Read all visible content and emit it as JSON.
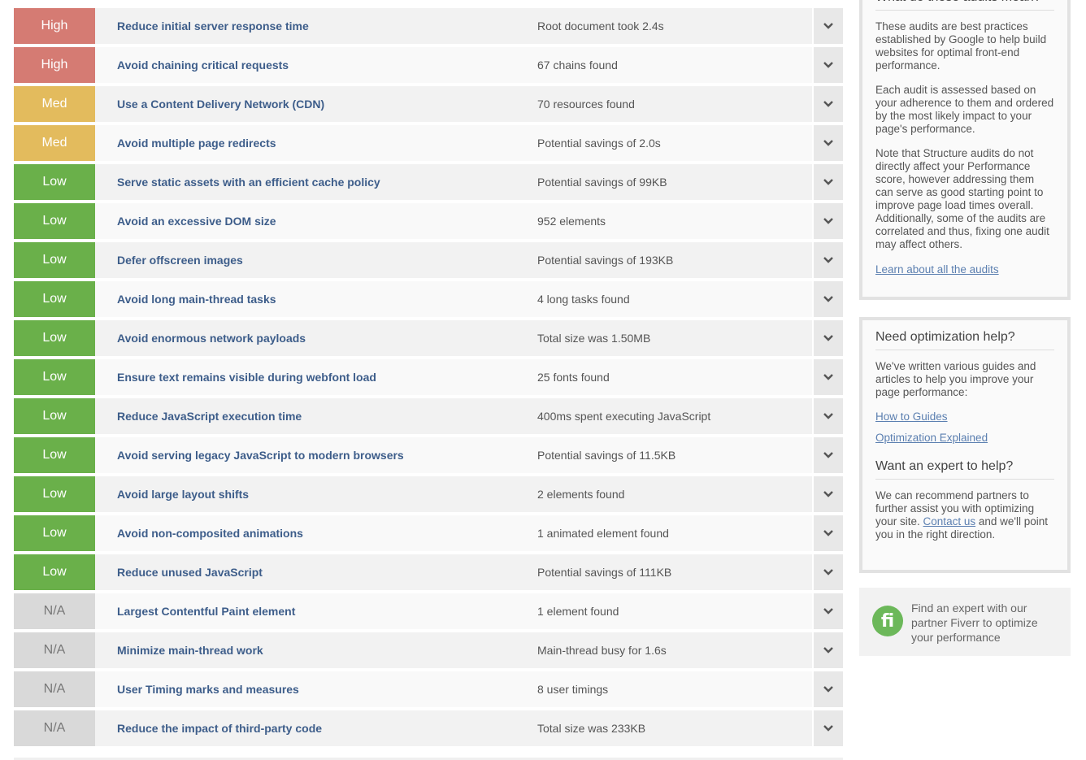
{
  "audits": [
    {
      "priority": "High",
      "level": "high",
      "title": "Reduce initial server response time",
      "detail": "Root document took 2.4s"
    },
    {
      "priority": "High",
      "level": "high",
      "title": "Avoid chaining critical requests",
      "detail": "67 chains found"
    },
    {
      "priority": "Med",
      "level": "med",
      "title": "Use a Content Delivery Network (CDN)",
      "detail": "70 resources found"
    },
    {
      "priority": "Med",
      "level": "med",
      "title": "Avoid multiple page redirects",
      "detail": "Potential savings of 2.0s"
    },
    {
      "priority": "Low",
      "level": "low",
      "title": "Serve static assets with an efficient cache policy",
      "detail": "Potential savings of 99KB"
    },
    {
      "priority": "Low",
      "level": "low",
      "title": "Avoid an excessive DOM size",
      "detail": "952 elements"
    },
    {
      "priority": "Low",
      "level": "low",
      "title": "Defer offscreen images",
      "detail": "Potential savings of 193KB"
    },
    {
      "priority": "Low",
      "level": "low",
      "title": "Avoid long main-thread tasks",
      "detail": "4 long tasks found"
    },
    {
      "priority": "Low",
      "level": "low",
      "title": "Avoid enormous network payloads",
      "detail": "Total size was 1.50MB"
    },
    {
      "priority": "Low",
      "level": "low",
      "title": "Ensure text remains visible during webfont load",
      "detail": "25 fonts found"
    },
    {
      "priority": "Low",
      "level": "low",
      "title": "Reduce JavaScript execution time",
      "detail": "400ms spent executing JavaScript"
    },
    {
      "priority": "Low",
      "level": "low",
      "title": "Avoid serving legacy JavaScript to modern browsers",
      "detail": "Potential savings of 11.5KB"
    },
    {
      "priority": "Low",
      "level": "low",
      "title": "Avoid large layout shifts",
      "detail": "2 elements found"
    },
    {
      "priority": "Low",
      "level": "low",
      "title": "Avoid non-composited animations",
      "detail": "1 animated element found"
    },
    {
      "priority": "Low",
      "level": "low",
      "title": "Reduce unused JavaScript",
      "detail": "Potential savings of 111KB"
    },
    {
      "priority": "N/A",
      "level": "na",
      "title": "Largest Contentful Paint element",
      "detail": "1 element found"
    },
    {
      "priority": "N/A",
      "level": "na",
      "title": "Minimize main-thread work",
      "detail": "Main-thread busy for 1.6s"
    },
    {
      "priority": "N/A",
      "level": "na",
      "title": "User Timing marks and measures",
      "detail": "8 user timings"
    },
    {
      "priority": "N/A",
      "level": "na",
      "title": "Reduce the impact of third-party code",
      "detail": "Total size was 233KB"
    }
  ],
  "sidebar": {
    "meaning": {
      "heading": "What do these audits mean?",
      "para1": "These audits are best practices established by Google to help build websites for optimal front-end performance.",
      "para2": "Each audit is assessed based on your adherence to them and ordered by the most likely impact to your page's performance.",
      "para3": "Note that Structure audits do not directly affect your Performance score, however addressing them can serve as good starting point to improve page load times overall. Additionally, some of the audits are correlated and thus, fixing one audit may affect others.",
      "link": "Learn about all the audits"
    },
    "help": {
      "heading": "Need optimization help?",
      "para": "We've written various guides and articles to help you improve your page performance:",
      "link1": "How to Guides",
      "link2": "Optimization Explained",
      "expert_heading": "Want an expert to help?",
      "expert_pre": "We can recommend partners to further assist you with optimizing your site.",
      "expert_link": "Contact us",
      "expert_post": "and we'll point you in the right direction."
    },
    "fiverr": {
      "logo": "fi",
      "text": "Find an expert with our partner Fiverr to optimize your performance"
    }
  },
  "icons": {
    "toggle": "chevron-down-icon"
  },
  "colors": {
    "high": "#d57b73",
    "med": "#e3bb5d",
    "low": "#6ab04a",
    "na": "#d9d9d9",
    "link": "#5b7fb0",
    "title": "#3d5d8a"
  }
}
